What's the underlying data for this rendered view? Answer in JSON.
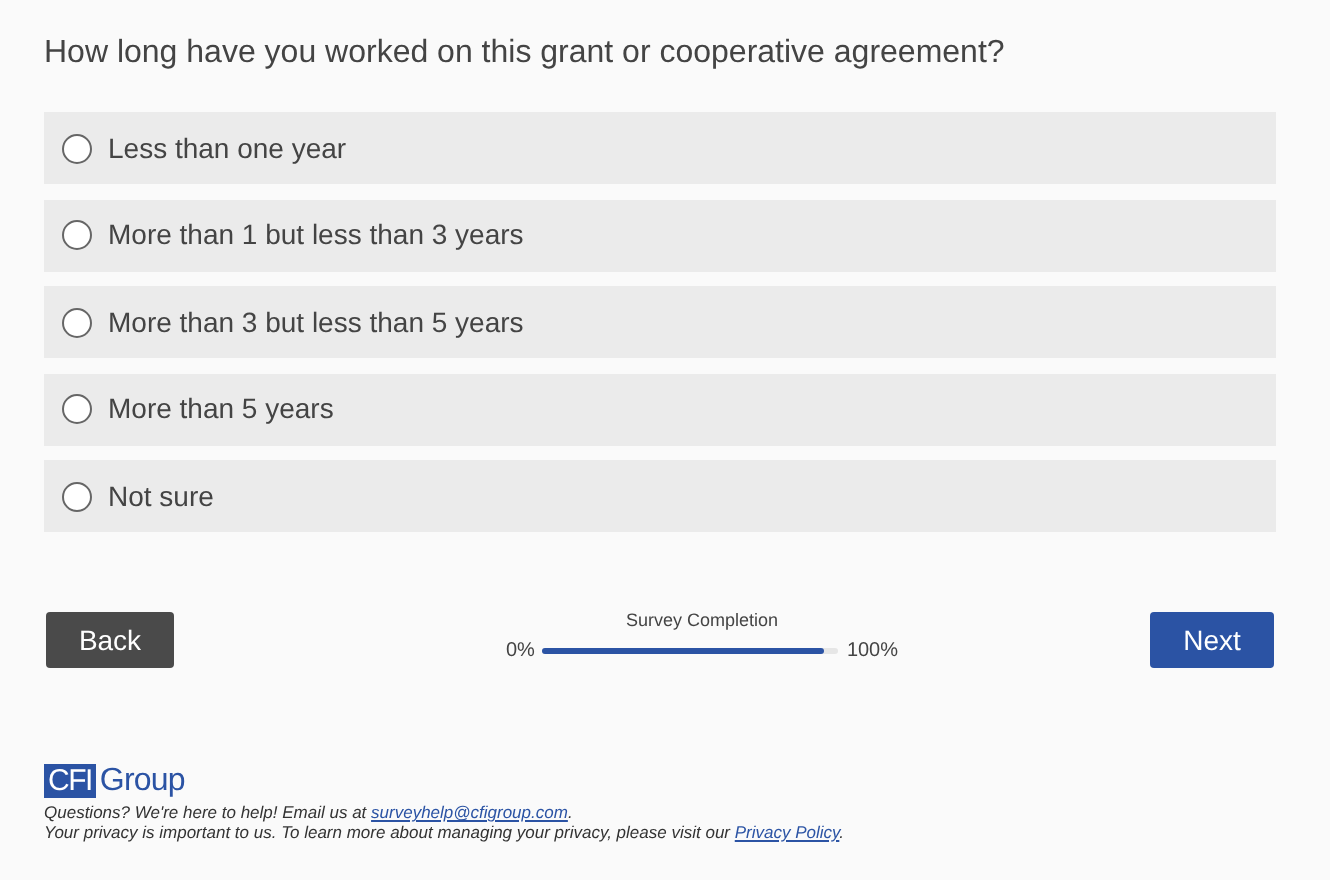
{
  "question": "How long have you worked on this grant or cooperative agreement?",
  "options": [
    {
      "label": "Less than one year",
      "selected": false
    },
    {
      "label": "More than 1 but less than 3 years",
      "selected": false
    },
    {
      "label": "More than 3 but less than 5 years",
      "selected": false
    },
    {
      "label": "More than 5 years",
      "selected": false
    },
    {
      "label": "Not sure",
      "selected": false
    }
  ],
  "back_button": "Back",
  "next_button": "Next",
  "progress": {
    "title": "Survey Completion",
    "start_label": "0%",
    "end_label": "100%",
    "level": 0.95
  },
  "footer": {
    "logo_mark": "CFI",
    "logo_word": "Group",
    "help_text": "Questions? We're here to help! Email us at ",
    "email": "surveyhelp@cfigroup.com",
    "help_end": ".",
    "privacy_text": "Your privacy is important to us. To learn more about managing your privacy, please visit our ",
    "privacy_link": "Privacy Policy",
    "privacy_end": "."
  }
}
